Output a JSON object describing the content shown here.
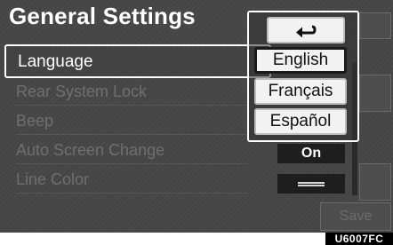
{
  "header": {
    "title": "General Settings"
  },
  "rows": {
    "language": {
      "label": "Language"
    },
    "rear_system_lock": {
      "label": "Rear System Lock"
    },
    "beep": {
      "label": "Beep"
    },
    "auto_screen_change": {
      "label": "Auto Screen Change",
      "value": "On"
    },
    "line_color": {
      "label": "Line Color"
    }
  },
  "popup": {
    "back_icon": "return-arrow-icon",
    "options": [
      {
        "label": "English",
        "selected": true
      },
      {
        "label": "Français",
        "selected": false
      },
      {
        "label": "Español",
        "selected": false
      }
    ]
  },
  "footer": {
    "save_label": "Save"
  },
  "image_code": "U6007FC",
  "colors": {
    "screen_bg": "#454545",
    "highlight": "#ffffff",
    "option_bg": "#f2f2f2"
  }
}
